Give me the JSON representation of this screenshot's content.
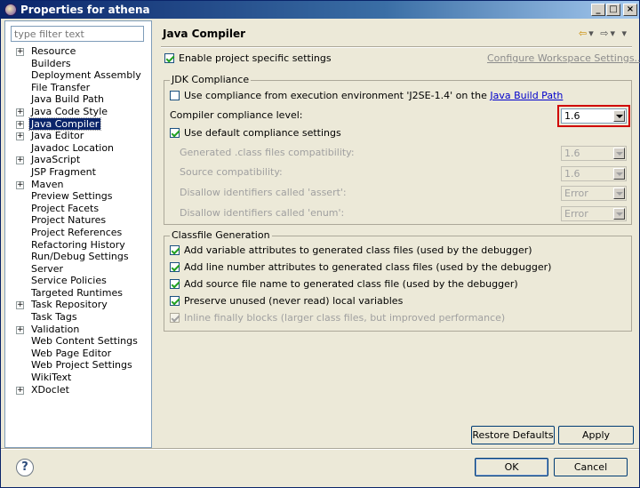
{
  "window": {
    "title": "Properties for athena"
  },
  "title_buttons": {
    "minimize": "_",
    "maximize": "□",
    "close": "×"
  },
  "filter": {
    "placeholder": "type filter text"
  },
  "tree": [
    {
      "label": "Resource",
      "expandable": true
    },
    {
      "label": "Builders",
      "expandable": false
    },
    {
      "label": "Deployment Assembly",
      "expandable": false
    },
    {
      "label": "File Transfer",
      "expandable": false
    },
    {
      "label": "Java Build Path",
      "expandable": false
    },
    {
      "label": "Java Code Style",
      "expandable": true
    },
    {
      "label": "Java Compiler",
      "expandable": true,
      "selected": true
    },
    {
      "label": "Java Editor",
      "expandable": true
    },
    {
      "label": "Javadoc Location",
      "expandable": false
    },
    {
      "label": "JavaScript",
      "expandable": true
    },
    {
      "label": "JSP Fragment",
      "expandable": false
    },
    {
      "label": "Maven",
      "expandable": true
    },
    {
      "label": "Preview Settings",
      "expandable": false
    },
    {
      "label": "Project Facets",
      "expandable": false
    },
    {
      "label": "Project Natures",
      "expandable": false
    },
    {
      "label": "Project References",
      "expandable": false
    },
    {
      "label": "Refactoring History",
      "expandable": false
    },
    {
      "label": "Run/Debug Settings",
      "expandable": false
    },
    {
      "label": "Server",
      "expandable": false
    },
    {
      "label": "Service Policies",
      "expandable": false
    },
    {
      "label": "Targeted Runtimes",
      "expandable": false
    },
    {
      "label": "Task Repository",
      "expandable": true
    },
    {
      "label": "Task Tags",
      "expandable": false
    },
    {
      "label": "Validation",
      "expandable": true
    },
    {
      "label": "Web Content Settings",
      "expandable": false
    },
    {
      "label": "Web Page Editor",
      "expandable": false
    },
    {
      "label": "Web Project Settings",
      "expandable": false
    },
    {
      "label": "WikiText",
      "expandable": false
    },
    {
      "label": "XDoclet",
      "expandable": true
    }
  ],
  "page": {
    "title": "Java Compiler",
    "nav": {
      "back": "⇦",
      "back_menu": "▾",
      "forward": "⇨",
      "forward_menu": "▾",
      "view_menu": "▾"
    },
    "enable_specific": {
      "label": "Enable project specific settings",
      "checked": true
    },
    "configure_link": "Configure Workspace Settings..."
  },
  "jdk": {
    "group_label": "JDK Compliance",
    "use_ee_prefix": "Use compliance from execution environment 'J2SE-1.4' on the ",
    "use_ee_link": "Java Build Path",
    "compliance_label": "Compiler compliance level:",
    "compliance_value": "1.6",
    "use_default": "Use default compliance settings",
    "generated_label": "Generated .class files compatibility:",
    "generated_value": "1.6",
    "source_label": "Source compatibility:",
    "source_value": "1.6",
    "assert_label": "Disallow identifiers called 'assert':",
    "assert_value": "Error",
    "enum_label": "Disallow identifiers called 'enum':",
    "enum_value": "Error"
  },
  "classfile": {
    "group_label": "Classfile Generation",
    "options": [
      {
        "label": "Add variable attributes to generated class files (used by the debugger)",
        "checked": true,
        "disabled": false
      },
      {
        "label": "Add line number attributes to generated class files (used by the debugger)",
        "checked": true,
        "disabled": false
      },
      {
        "label": "Add source file name to generated class file (used by the debugger)",
        "checked": true,
        "disabled": false
      },
      {
        "label": "Preserve unused (never read) local variables",
        "checked": true,
        "disabled": false
      },
      {
        "label": "Inline finally blocks (larger class files, but improved performance)",
        "checked": true,
        "disabled": true
      }
    ]
  },
  "buttons": {
    "restore_defaults": "Restore Defaults",
    "apply": "Apply",
    "ok": "OK",
    "cancel": "Cancel",
    "help": "?"
  }
}
